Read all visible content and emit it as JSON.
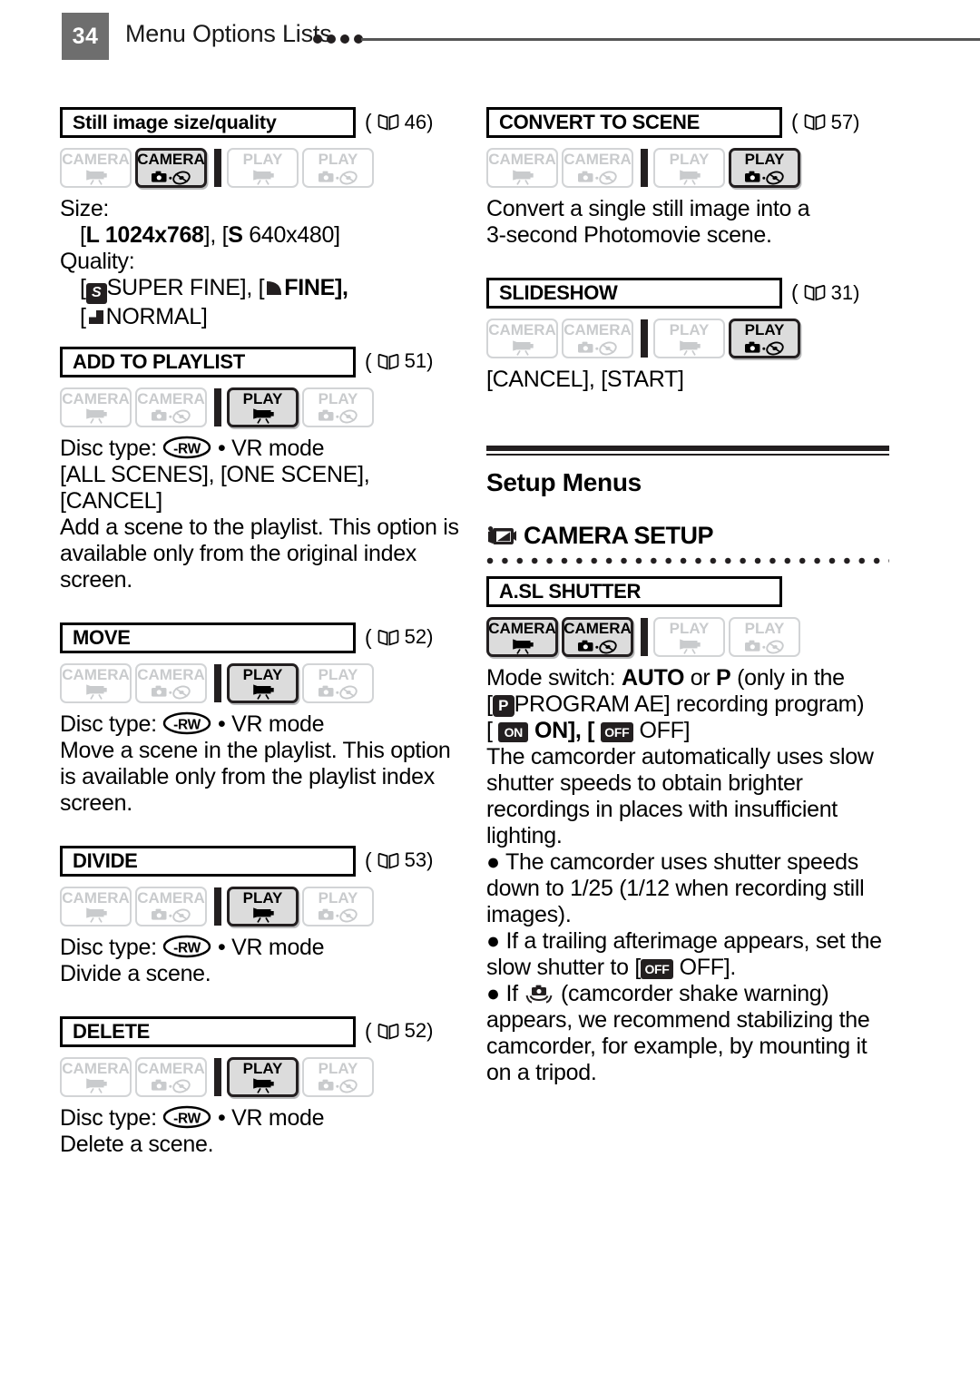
{
  "header": {
    "page_number": "34",
    "title": "Menu Options Lists",
    "dot_count": 4,
    "rule_color": "#555555",
    "page_box_color": "#6e6e6e"
  },
  "mode_badge_labels": {
    "camera": "CAMERA",
    "play": "PLAY",
    "movie_icon": "camcorder-icon",
    "photo_icon": "camera-disc-icon"
  },
  "left_column": {
    "entries": [
      {
        "name": "Still image size/quality",
        "name_style": "mixed",
        "page_ref": "46",
        "modes": [
          false,
          true,
          false,
          false
        ],
        "lines": [
          {
            "kind": "text",
            "text": "Size:"
          },
          {
            "kind": "size",
            "indent": true,
            "prefix": "[",
            "l_tag": "L",
            "l_value": " 1024x768], [",
            "s_tag": "S",
            "s_value": " 640x480]"
          },
          {
            "kind": "text",
            "text": "Quality:"
          },
          {
            "kind": "quality1",
            "indent": true,
            "a": "SUPER FINE], [",
            "b": "FINE],",
            "open": "[",
            "mid": "["
          },
          {
            "kind": "quality2",
            "indent": true,
            "open": "[",
            "text": "NORMAL]"
          }
        ]
      },
      {
        "name": "ADD TO PLAYLIST",
        "page_ref": "51",
        "modes": [
          false,
          false,
          true,
          false
        ],
        "lines": [
          {
            "kind": "disc",
            "prefix": "Disc type:",
            "suffix": "• VR mode"
          },
          {
            "kind": "text",
            "text": "[ALL SCENES], [ONE SCENE],"
          },
          {
            "kind": "text",
            "text": "[CANCEL]"
          },
          {
            "kind": "wrap",
            "text": "Add a scene to the playlist. This option is available only from the original index screen."
          }
        ]
      },
      {
        "name": "MOVE",
        "page_ref": "52",
        "modes": [
          false,
          false,
          true,
          false
        ],
        "lines": [
          {
            "kind": "disc",
            "prefix": "Disc type:",
            "suffix": "• VR mode"
          },
          {
            "kind": "wrap",
            "text": "Move a scene in the playlist. This option is available only from the playlist index screen."
          }
        ]
      },
      {
        "name": "DIVIDE",
        "page_ref": "53",
        "modes": [
          false,
          false,
          true,
          false
        ],
        "lines": [
          {
            "kind": "disc",
            "prefix": "Disc type:",
            "suffix": "• VR mode"
          },
          {
            "kind": "text",
            "text": "Divide a scene."
          }
        ]
      },
      {
        "name": "DELETE",
        "page_ref": "52",
        "modes": [
          false,
          false,
          true,
          false
        ],
        "lines": [
          {
            "kind": "disc",
            "prefix": "Disc type:",
            "suffix": "• VR mode"
          },
          {
            "kind": "text",
            "text": "Delete a scene."
          }
        ]
      }
    ]
  },
  "right_column": {
    "entries": [
      {
        "name": "CONVERT TO SCENE",
        "page_ref": "57",
        "modes": [
          false,
          false,
          false,
          true
        ],
        "lines": [
          {
            "kind": "text",
            "text": "Convert a single still image into a"
          },
          {
            "kind": "text",
            "text": "3-second Photomovie scene."
          }
        ]
      },
      {
        "name": "SLIDESHOW",
        "page_ref": "31",
        "modes": [
          false,
          false,
          false,
          true
        ],
        "lines": [
          {
            "kind": "text",
            "text": "[CANCEL], [START]"
          }
        ]
      }
    ],
    "section": {
      "title": "Setup Menus",
      "submenu_title": "CAMERA SETUP",
      "submenu_icon": "camcorder-setup-icon",
      "entries": [
        {
          "name": "A.SL SHUTTER",
          "page_ref": "",
          "modes": [
            true,
            true,
            false,
            false
          ],
          "lines": [
            {
              "kind": "modeswitch",
              "pre": "Mode switch: ",
              "auto": "AUTO",
              "or": " or ",
              "p": "P",
              "post": " (only in the"
            },
            {
              "kind": "program",
              "open": "[",
              "chip": "P",
              "text": "PROGRAM AE] recording program)"
            },
            {
              "kind": "onoff",
              "open": "[",
              "on_chip": "ON",
              "on_text": " ON], [",
              "off_chip": "OFF",
              "off_text": " OFF]"
            },
            {
              "kind": "wrap",
              "text": "The camcorder automatically uses slow shutter speeds to obtain brighter recordings in places with insufficient lighting."
            },
            {
              "kind": "bullet_wrap",
              "bullet": "●",
              "text": "The camcorder uses shutter speeds down to 1/25 (1/12 when recording still images)."
            },
            {
              "kind": "bullet_off",
              "bullet": "●",
              "pre": "If a trailing afterimage appears, set the slow shutter to [",
              "chip": "OFF",
              "post": " OFF]."
            },
            {
              "kind": "bullet_shake",
              "bullet": "●",
              "pre": "If",
              "shake_icon": "camcorder-shake-icon",
              "post": "(camcorder shake warning) appears, we recommend stabilizing the camcorder, for example, by mounting it on a tripod."
            }
          ]
        }
      ]
    }
  }
}
